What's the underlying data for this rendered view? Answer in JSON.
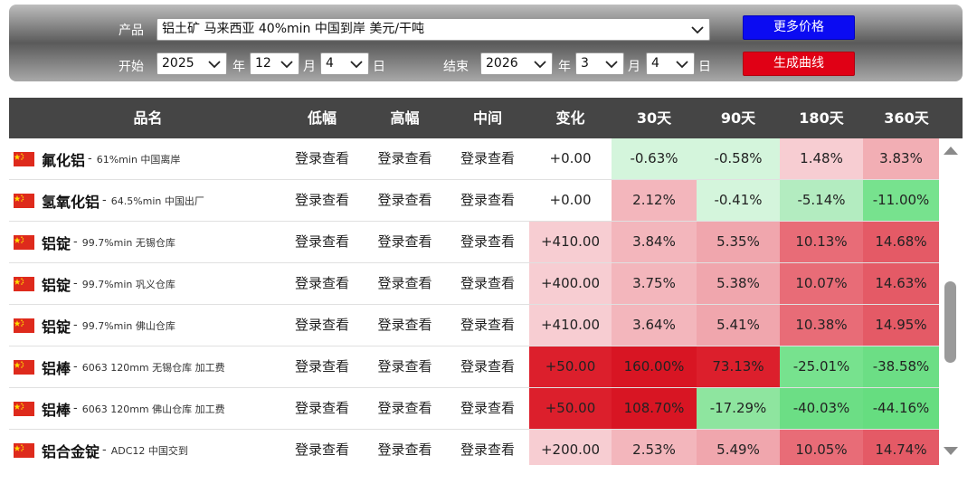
{
  "controls": {
    "product_label": "产品",
    "product_value": "铝土矿 马来西亚 40%min 中国到岸 美元/干吨",
    "more_prices": "更多价格",
    "start_label": "开始",
    "start_year": "2025",
    "start_month": "12",
    "start_day": "4",
    "end_label": "结束",
    "end_year": "2026",
    "end_month": "3",
    "end_day": "4",
    "year_unit": "年",
    "month_unit": "月",
    "day_unit": "日",
    "generate": "生成曲线"
  },
  "columns": [
    "品名",
    "低幅",
    "高幅",
    "中间",
    "变化",
    "30天",
    "90天",
    "180天",
    "360天"
  ],
  "login_text": "登录查看",
  "rows": [
    {
      "name": "氟化铝",
      "desc": "61%min 中国离岸",
      "change": "+0.00",
      "d30": "-0.63%",
      "d90": "-0.58%",
      "d180": "1.48%",
      "d360": "3.83%",
      "colors": {
        "change": "#ffffff",
        "d30": "#d4f5dc",
        "d90": "#d4f5dc",
        "d180": "#f7cdd2",
        "d360": "#f2aeb4"
      }
    },
    {
      "name": "氢氧化铝",
      "desc": "64.5%min 中国出厂",
      "change": "+0.00",
      "d30": "2.12%",
      "d90": "-0.41%",
      "d180": "-5.14%",
      "d360": "-11.00%",
      "colors": {
        "change": "#ffffff",
        "d30": "#f3b6bc",
        "d90": "#d4f5dc",
        "d180": "#b3ecc0",
        "d360": "#77e28e"
      }
    },
    {
      "name": "铝锭",
      "desc": "99.7%min 无锡仓库",
      "change": "+410.00",
      "d30": "3.84%",
      "d90": "5.35%",
      "d180": "10.13%",
      "d360": "14.68%",
      "colors": {
        "change": "#f7cdd2",
        "d30": "#f3b6bc",
        "d90": "#f0a6ad",
        "d180": "#e86c77",
        "d360": "#e45a66"
      }
    },
    {
      "name": "铝锭",
      "desc": "99.7%min 巩义仓库",
      "change": "+400.00",
      "d30": "3.75%",
      "d90": "5.38%",
      "d180": "10.07%",
      "d360": "14.63%",
      "colors": {
        "change": "#f7cdd2",
        "d30": "#f3b6bc",
        "d90": "#f0a6ad",
        "d180": "#e86c77",
        "d360": "#e45a66"
      }
    },
    {
      "name": "铝锭",
      "desc": "99.7%min 佛山仓库",
      "change": "+410.00",
      "d30": "3.64%",
      "d90": "5.41%",
      "d180": "10.38%",
      "d360": "14.95%",
      "colors": {
        "change": "#f7cdd2",
        "d30": "#f3b6bc",
        "d90": "#f0a6ad",
        "d180": "#e86c77",
        "d360": "#e45a66"
      }
    },
    {
      "name": "铝棒",
      "desc": "6063 120mm 无锡仓库 加工费",
      "change": "+50.00",
      "d30": "160.00%",
      "d90": "73.13%",
      "d180": "-25.01%",
      "d360": "-38.58%",
      "colors": {
        "change": "#dc1f2c",
        "d30": "#d81523",
        "d90": "#dc1f2c",
        "d180": "#77e28e",
        "d360": "#6cde85"
      }
    },
    {
      "name": "铝棒",
      "desc": "6063 120mm 佛山仓库 加工费",
      "change": "+50.00",
      "d30": "108.70%",
      "d90": "-17.29%",
      "d180": "-40.03%",
      "d360": "-44.16%",
      "colors": {
        "change": "#dc1f2c",
        "d30": "#d81523",
        "d90": "#8ee59f",
        "d180": "#6cde85",
        "d360": "#66dd80"
      }
    },
    {
      "name": "铝合金锭",
      "desc": "ADC12 中国交到",
      "change": "+200.00",
      "d30": "2.53%",
      "d90": "5.49%",
      "d180": "10.05%",
      "d360": "14.74%",
      "colors": {
        "change": "#f7cdd2",
        "d30": "#f3b6bc",
        "d90": "#f0a6ad",
        "d180": "#e86c77",
        "d360": "#e45a66"
      }
    }
  ],
  "colors": {
    "header_bg": "#454545",
    "more_button": "#0b0bf2",
    "generate_button": "#e00015",
    "flag_red": "#de2a1c",
    "flag_star": "#ffde00"
  }
}
